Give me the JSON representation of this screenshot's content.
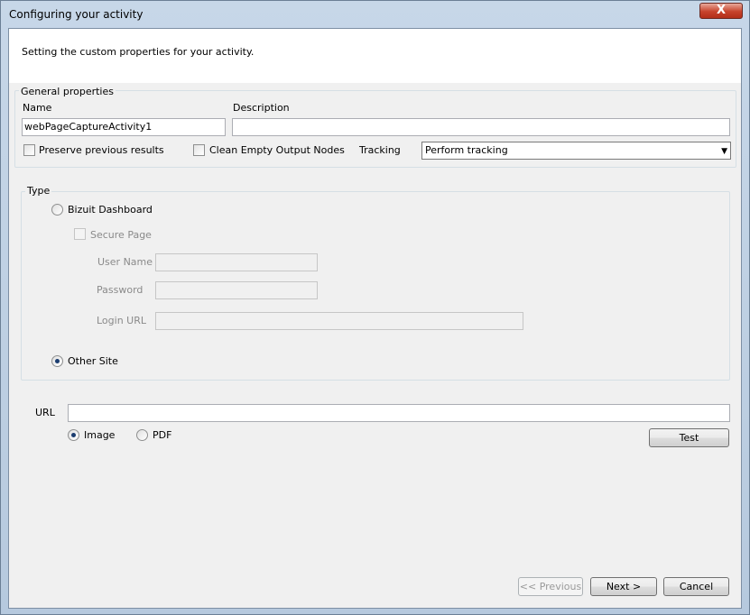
{
  "window": {
    "title": "Configuring your activity",
    "close_glyph": "X"
  },
  "header": {
    "text": "Setting the custom properties for your activity."
  },
  "general": {
    "title": "General properties",
    "name_label": "Name",
    "name_value": "webPageCaptureActivity1",
    "description_label": "Description",
    "description_value": "",
    "preserve_label": "Preserve previous results",
    "clean_label": "Clean Empty Output Nodes",
    "tracking_label": "Tracking",
    "tracking_value": "Perform tracking"
  },
  "type": {
    "title": "Type",
    "bizuit_label": "Bizuit Dashboard",
    "secure_label": "Secure Page",
    "username_label": "User Name",
    "password_label": "Password",
    "loginurl_label": "Login URL",
    "other_label": "Other Site"
  },
  "url": {
    "label": "URL",
    "value": "",
    "image_label": "Image",
    "pdf_label": "PDF",
    "test_label": "Test"
  },
  "footer": {
    "previous_label": "<< Previous",
    "next_label": "Next >",
    "cancel_label": "Cancel"
  }
}
